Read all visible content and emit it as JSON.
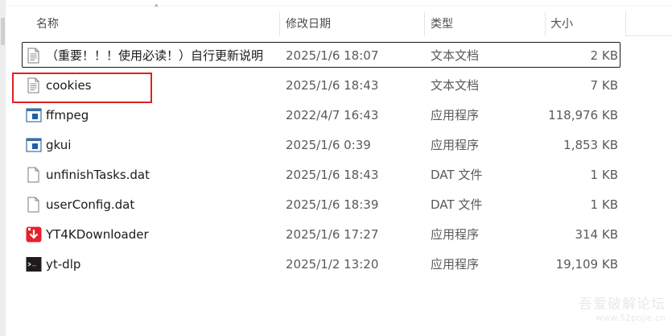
{
  "columns": {
    "name": "名称",
    "date": "修改日期",
    "type": "类型",
    "size": "大小"
  },
  "files": [
    {
      "name": "（重要！！！使用必读！）自行更新说明",
      "date": "2025/1/6 18:07",
      "type": "文本文档",
      "size": "2 KB",
      "icon": "text-document-icon"
    },
    {
      "name": "cookies",
      "date": "2025/1/6 18:43",
      "type": "文本文档",
      "size": "7 KB",
      "icon": "text-document-icon"
    },
    {
      "name": "ffmpeg",
      "date": "2022/4/7 16:43",
      "type": "应用程序",
      "size": "118,976 KB",
      "icon": "application-window-icon"
    },
    {
      "name": "gkui",
      "date": "2025/1/6 0:39",
      "type": "应用程序",
      "size": "1,853 KB",
      "icon": "application-window-icon"
    },
    {
      "name": "unfinishTasks.dat",
      "date": "2025/1/6 18:43",
      "type": "DAT 文件",
      "size": "1 KB",
      "icon": "blank-file-icon"
    },
    {
      "name": "userConfig.dat",
      "date": "2025/1/6 18:39",
      "type": "DAT 文件",
      "size": "1 KB",
      "icon": "blank-file-icon"
    },
    {
      "name": "YT4KDownloader",
      "date": "2025/1/6 17:27",
      "type": "应用程序",
      "size": "314 KB",
      "icon": "yt4k-downloader-icon"
    },
    {
      "name": "yt-dlp",
      "date": "2025/1/2 13:20",
      "type": "应用程序",
      "size": "19,109 KB",
      "icon": "terminal-app-icon"
    }
  ],
  "watermark": {
    "line1": "吾爱破解论坛",
    "line2": "www.52pojie.cn"
  },
  "colors": {
    "annotation_red": "#e02020",
    "yt4k_red": "#e8202a"
  }
}
